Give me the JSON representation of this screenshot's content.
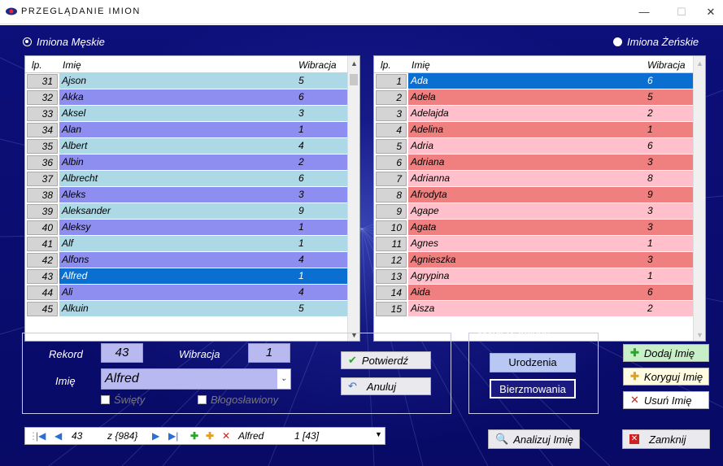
{
  "window": {
    "title": "PRZEGLĄDANIE IMION"
  },
  "radios": {
    "male": "Imiona Męskie",
    "female": "Imiona Żeńskie"
  },
  "columns": {
    "lp": "lp.",
    "name": "Imię",
    "vibration": "Wibracja"
  },
  "male_rows": [
    {
      "lp": "31",
      "name": "Ajson",
      "wib": "5",
      "band": "a"
    },
    {
      "lp": "32",
      "name": "Akka",
      "wib": "6",
      "band": "b"
    },
    {
      "lp": "33",
      "name": "Aksel",
      "wib": "3",
      "band": "a"
    },
    {
      "lp": "34",
      "name": "Alan",
      "wib": "1",
      "band": "b"
    },
    {
      "lp": "35",
      "name": "Albert",
      "wib": "4",
      "band": "a"
    },
    {
      "lp": "36",
      "name": "Albin",
      "wib": "2",
      "band": "b"
    },
    {
      "lp": "37",
      "name": "Albrecht",
      "wib": "6",
      "band": "a"
    },
    {
      "lp": "38",
      "name": "Aleks",
      "wib": "3",
      "band": "b"
    },
    {
      "lp": "39",
      "name": "Aleksander",
      "wib": "9",
      "band": "a"
    },
    {
      "lp": "40",
      "name": "Aleksy",
      "wib": "1",
      "band": "b"
    },
    {
      "lp": "41",
      "name": "Alf",
      "wib": "1",
      "band": "a"
    },
    {
      "lp": "42",
      "name": "Alfons",
      "wib": "4",
      "band": "b"
    },
    {
      "lp": "43",
      "name": "Alfred",
      "wib": "1",
      "band": "sel"
    },
    {
      "lp": "44",
      "name": "Ali",
      "wib": "4",
      "band": "b"
    },
    {
      "lp": "45",
      "name": "Alkuin",
      "wib": "5",
      "band": "a"
    }
  ],
  "female_rows": [
    {
      "lp": "1",
      "name": "Ada",
      "wib": "6",
      "band": "sel"
    },
    {
      "lp": "2",
      "name": "Adela",
      "wib": "5",
      "band": "b"
    },
    {
      "lp": "3",
      "name": "Adelajda",
      "wib": "2",
      "band": "a"
    },
    {
      "lp": "4",
      "name": "Adelina",
      "wib": "1",
      "band": "b"
    },
    {
      "lp": "5",
      "name": "Adria",
      "wib": "6",
      "band": "a"
    },
    {
      "lp": "6",
      "name": "Adriana",
      "wib": "3",
      "band": "b"
    },
    {
      "lp": "7",
      "name": "Adrianna",
      "wib": "8",
      "band": "a"
    },
    {
      "lp": "8",
      "name": "Afrodyta",
      "wib": "9",
      "band": "b"
    },
    {
      "lp": "9",
      "name": "Agape",
      "wib": "3",
      "band": "a"
    },
    {
      "lp": "10",
      "name": "Agata",
      "wib": "3",
      "band": "b"
    },
    {
      "lp": "11",
      "name": "Agnes",
      "wib": "1",
      "band": "a"
    },
    {
      "lp": "12",
      "name": "Agnieszka",
      "wib": "3",
      "band": "b"
    },
    {
      "lp": "13",
      "name": "Agrypina",
      "wib": "1",
      "band": "a"
    },
    {
      "lp": "14",
      "name": "Aida",
      "wib": "6",
      "band": "b"
    },
    {
      "lp": "15",
      "name": "Aisza",
      "wib": "2",
      "band": "a"
    }
  ],
  "record": {
    "label_record": "Rekord",
    "record": "43",
    "label_vibration": "Wibracja",
    "vibration": "1",
    "label_name": "Imię",
    "name": "Alfred",
    "chk_saint": "Święty",
    "chk_blessed": "Błogosławiony"
  },
  "buttons": {
    "confirm": "Potwierdź",
    "cancel": "Anuluj",
    "choose_title": "Wybierz Imiona",
    "birth": "Urodzenia",
    "confirmation": "Bierzmowania",
    "add": "Dodaj Imię",
    "edit": "Koryguj Imię",
    "delete": "Usuń Imię",
    "analyze": "Analizuj Imię",
    "close": "Zamknij"
  },
  "navigator": {
    "position": "43",
    "count": "z {984}",
    "name": "Alfred",
    "value": "1 [43]"
  },
  "colors": {
    "male_a": "#add8e6",
    "male_b": "#8e8ef0",
    "selected": "#0a6fd1",
    "female_a": "#ffc0cb",
    "female_b": "#f08080"
  }
}
